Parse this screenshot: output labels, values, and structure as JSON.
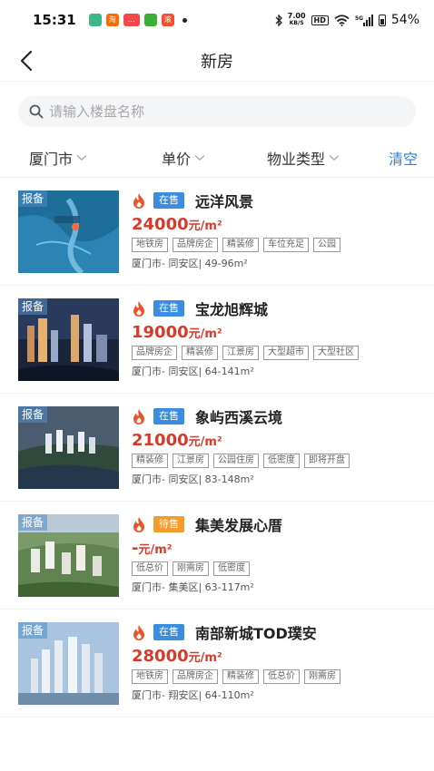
{
  "status_bar": {
    "time": "15:31",
    "net_speed_value": "7.00",
    "net_speed_unit": "KB/S",
    "hd": "HD",
    "battery": "54%",
    "app_icons": [
      {
        "name": "app-1-icon",
        "color": "#3fb58a",
        "label": ""
      },
      {
        "name": "taobao-icon",
        "color": "#ff6a00",
        "label": "淘"
      },
      {
        "name": "app-3-icon",
        "color": "#f2484b",
        "label": "…"
      },
      {
        "name": "wechat-icon",
        "color": "#3cb034",
        "label": ""
      },
      {
        "name": "app-5-icon",
        "color": "#f0512a",
        "label": "滚"
      }
    ]
  },
  "nav": {
    "title": "新房"
  },
  "search": {
    "placeholder": "请输入楼盘名称",
    "value": ""
  },
  "filters": {
    "city": "厦门市",
    "price": "单价",
    "property_type": "物业类型",
    "clear": "清空"
  },
  "colors": {
    "accent": "#2f7fd8",
    "price": "#d63b2a",
    "status_on_sale": "#3a8de0",
    "status_pending": "#f59b2b"
  },
  "listings": [
    {
      "badge": "报备",
      "status": "在售",
      "status_type": "on",
      "name": "远洋风景",
      "price": "24000",
      "unit": "元/m²",
      "tags": [
        "地铁房",
        "品牌房企",
        "精装修",
        "车位充足",
        "公园"
      ],
      "location": "厦门市- 同安区| 49-96m²"
    },
    {
      "badge": "报备",
      "status": "在售",
      "status_type": "on",
      "name": "宝龙旭辉城",
      "price": "19000",
      "unit": "元/m²",
      "tags": [
        "品牌房企",
        "精装修",
        "江景房",
        "大型超市",
        "大型社区"
      ],
      "location": "厦门市- 同安区| 64-141m²"
    },
    {
      "badge": "报备",
      "status": "在售",
      "status_type": "on",
      "name": "象屿西溪云境",
      "price": "21000",
      "unit": "元/m²",
      "tags": [
        "精装修",
        "江景房",
        "公园住房",
        "低密度",
        "即将开盘"
      ],
      "location": "厦门市- 同安区| 83-148m²"
    },
    {
      "badge": "报备",
      "status": "待售",
      "status_type": "wait",
      "name": "集美发展心厝",
      "price": "-",
      "unit": "元/m²",
      "tags": [
        "低总价",
        "刚需房",
        "低密度"
      ],
      "location": "厦门市- 集美区| 63-117m²"
    },
    {
      "badge": "报备",
      "status": "在售",
      "status_type": "on",
      "name": "南部新城TOD璞安",
      "price": "28000",
      "unit": "元/m²",
      "tags": [
        "地铁房",
        "品牌房企",
        "精装修",
        "低总价",
        "刚需房"
      ],
      "location": "厦门市- 翔安区| 64-110m²"
    }
  ]
}
